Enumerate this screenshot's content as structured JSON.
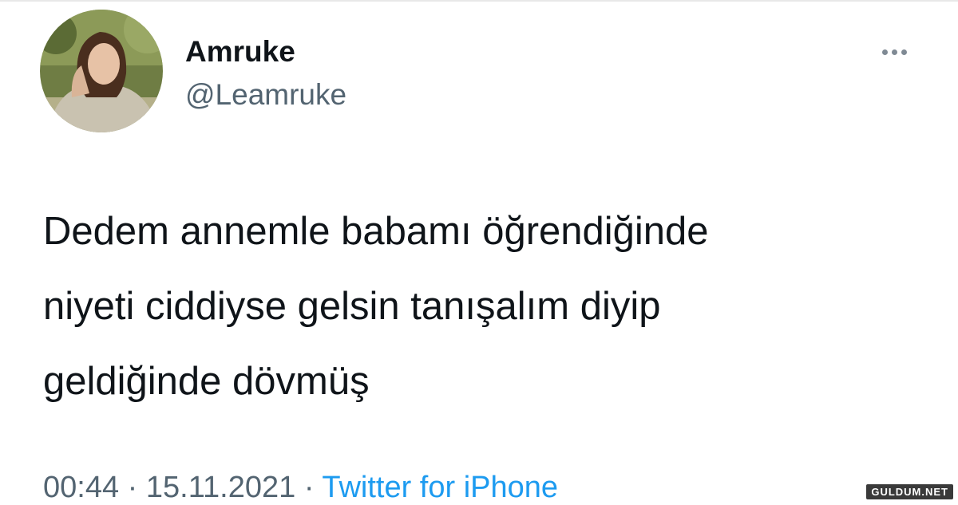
{
  "tweet": {
    "display_name": "Amruke",
    "handle": "@Leamruke",
    "text": "Dedem annemle babamı öğrendiğinde\nniyeti ciddiyse gelsin tanışalım diyip\ngeldiğinde dövmüş",
    "time": "00:44",
    "date": "15.11.2021",
    "separator": "·",
    "source": "Twitter for iPhone",
    "more_icon": "more-horizontal-icon",
    "avatar": "profile-photo"
  },
  "watermark": "GULDUM.NET",
  "colors": {
    "text": "#0f1419",
    "secondary": "#536471",
    "link": "#1d9bf0",
    "background": "#ffffff"
  }
}
